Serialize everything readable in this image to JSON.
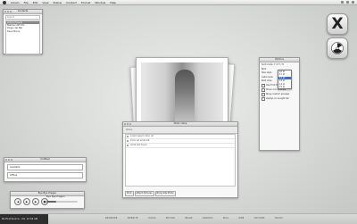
{
  "menubar": {
    "items": [
      "Adium",
      "File",
      "Edit",
      "View",
      "Status",
      "Contact",
      "Format",
      "Window",
      "Help"
    ]
  },
  "contacts": {
    "title": "Contacts",
    "search_placeholder": "Search",
    "items": [
      "Online Friends",
      "Mebraun NT Ent",
      "Chapo del Mar",
      "Dave Moore"
    ]
  },
  "chat": {
    "title": "Chat / Alice",
    "header_name": "Alice",
    "messages": [
      "Lorem ipsum dolor sit",
      "Dolor sit amet elit",
      "Amet elit donec"
    ],
    "toolbar": [
      "Print",
      "Attach Pictures",
      "Bring Site Photo"
    ]
  },
  "prefs": {
    "title": "Options",
    "font_label": "Sort mode: 7 of 7 / 8",
    "rows": [
      "Bold",
      "Size style",
      "Label view",
      "Bold view"
    ],
    "checks": [
      "Use Font Full",
      "Show icon preview",
      "Show custom preview",
      "Always on bought list"
    ],
    "dropdown": [
      "10 pt",
      "11 pt",
      "12 pt",
      "13 pt",
      "14 pt",
      "15 pt"
    ],
    "dropdown_selected": 2
  },
  "status": {
    "title": "Untitled",
    "field1": "Available",
    "field2": "Offline"
  },
  "player": {
    "title": "Bye Bye Pragen",
    "track": "Bye Bye Pragen",
    "progress": 0.3
  },
  "dock": {
    "left_label": "No First Source - Vol. 12:34 AM",
    "items": [
      "BROWSER",
      "WEBSITE",
      "CLOCK",
      "EDITOR",
      "IMAGE",
      "GRAPHIC",
      "MAIL",
      "WEB",
      "OPTIONS",
      "TRASH"
    ]
  }
}
